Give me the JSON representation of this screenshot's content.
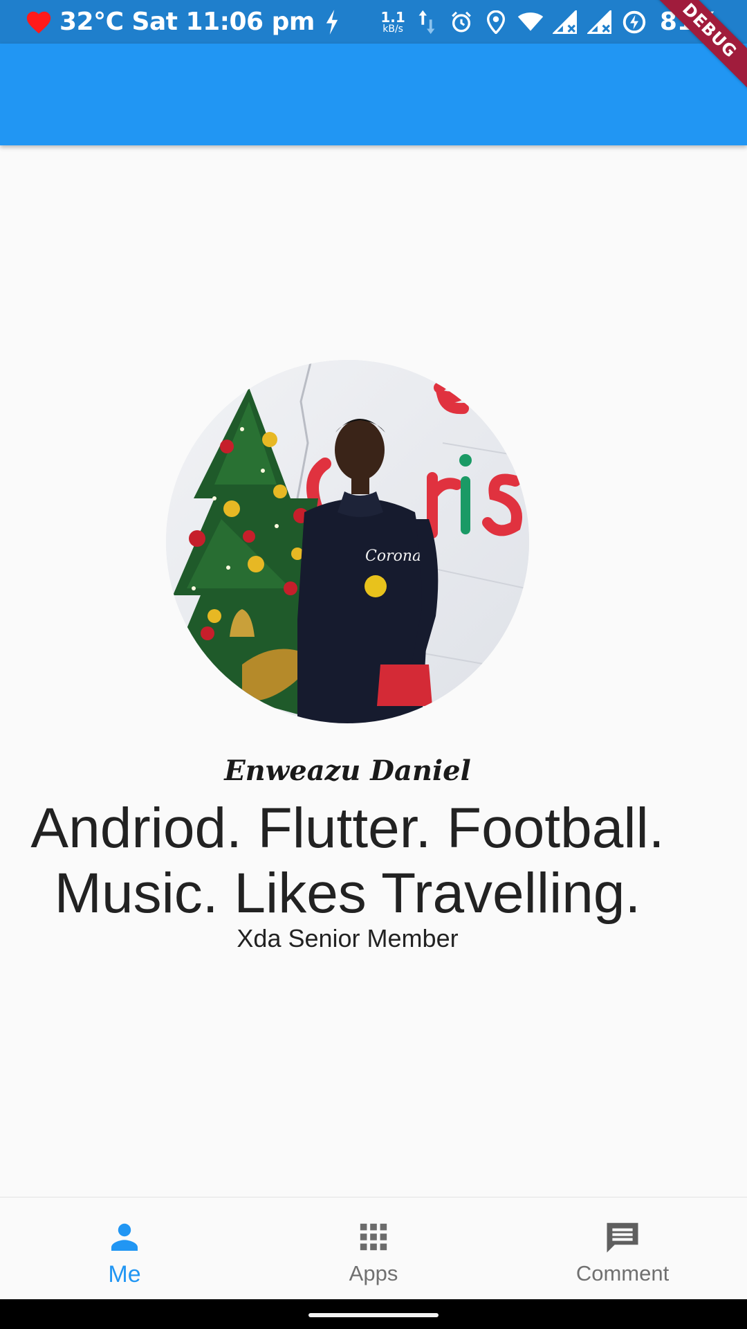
{
  "status_bar": {
    "weather_time": "32°C Sat 11:06 pm",
    "net_rate": "1.1",
    "net_unit": "kB/s",
    "battery": "81%",
    "icons": [
      "heart-icon",
      "flash-icon",
      "alarm-icon",
      "location-icon",
      "wifi-icon",
      "signal-icon",
      "battery-saver-icon"
    ]
  },
  "debug_banner": "DEBUG",
  "profile": {
    "name": "Enweazu Daniel",
    "bio": "Andriod. Flutter. Football. Music. Likes Travelling.",
    "subtitle": "Xda Senior Member"
  },
  "bottom_nav": {
    "items": [
      {
        "label": "Me",
        "icon": "person-icon",
        "active": true
      },
      {
        "label": "Apps",
        "icon": "apps-grid-icon",
        "active": false
      },
      {
        "label": "Comment",
        "icon": "comment-icon",
        "active": false
      }
    ]
  },
  "colors": {
    "status_bar": "#1f7fcc",
    "app_bar": "#2196f3",
    "active": "#2196f3",
    "inactive": "#707070",
    "debug": "#a01c3c"
  }
}
